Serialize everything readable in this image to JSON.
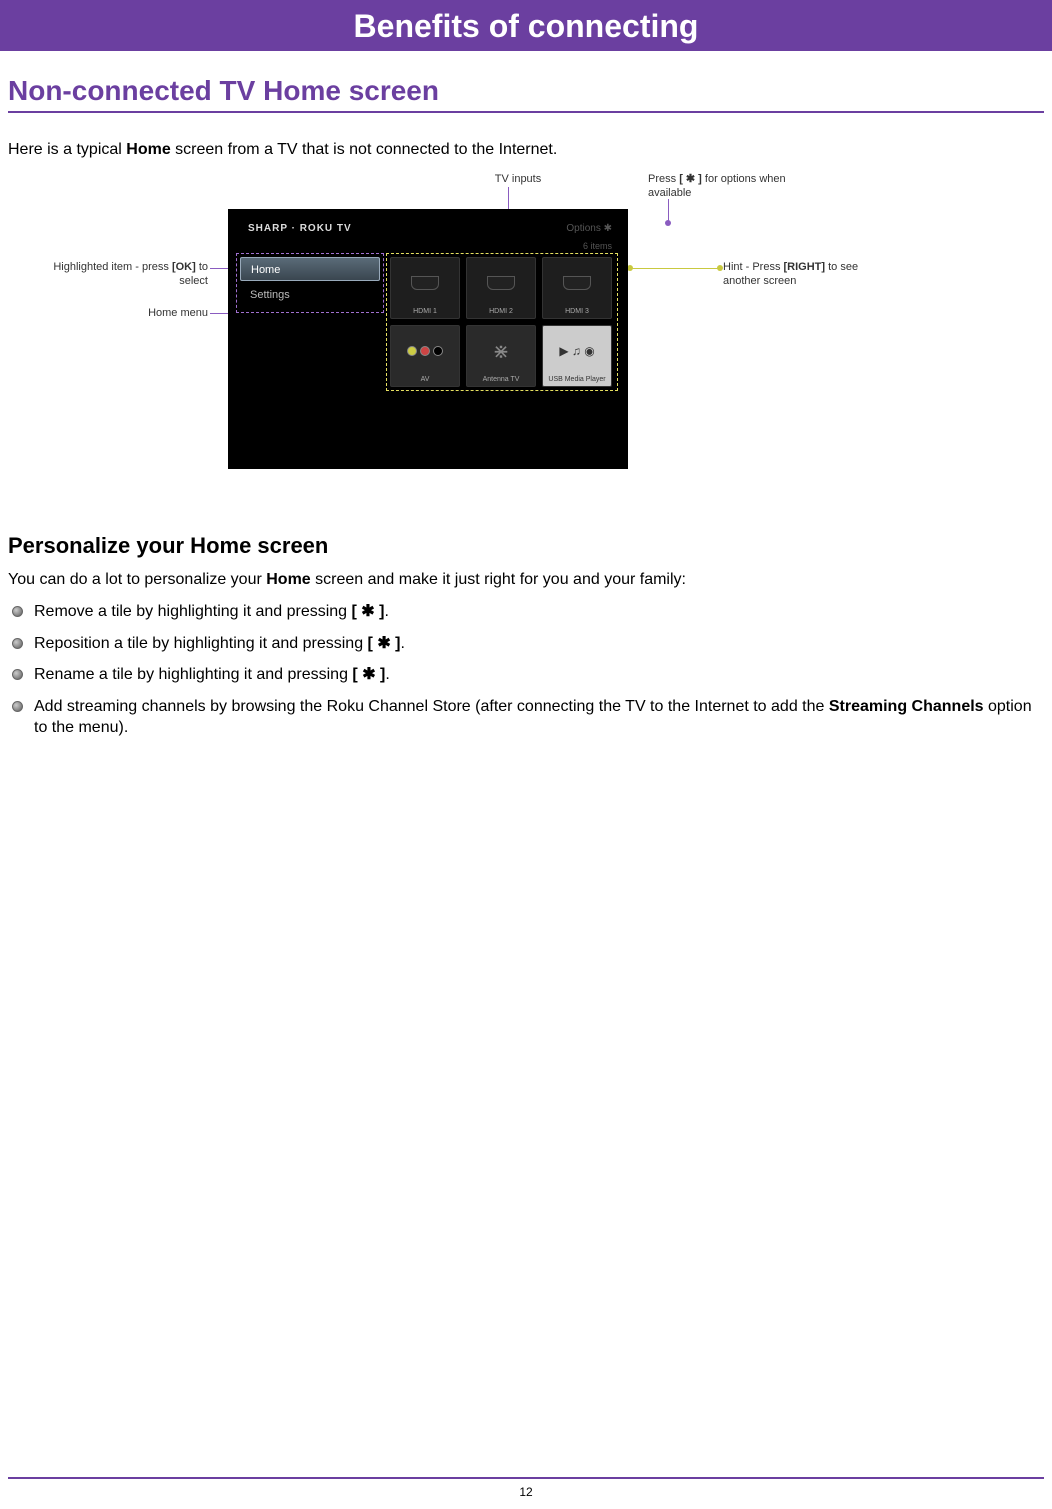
{
  "banner": "Benefits of connecting",
  "h1": "Non-connected TV Home screen",
  "intro_pre": "Here is a typical ",
  "intro_bold": "Home",
  "intro_post": " screen from a TV that is not connected to the Internet.",
  "callouts": {
    "tv_inputs": "TV inputs",
    "options_pre": "Press ",
    "options_key": "[ ✱ ]",
    "options_post": " for options when available",
    "highlight_pre": "Highlighted item - press ",
    "highlight_key": "[OK]",
    "highlight_post": " to select",
    "home_menu": "Home menu",
    "hint_pre": "Hint - Press ",
    "hint_key": "[RIGHT]",
    "hint_post": " to see another screen"
  },
  "tv": {
    "logo": "SHARP · ROKU TV",
    "options": "Options ✱",
    "items": "6 items",
    "menu": {
      "home": "Home",
      "settings": "Settings"
    },
    "tiles": {
      "hdmi1": "HDMI 1",
      "hdmi2": "HDMI 2",
      "hdmi3": "HDMI 3",
      "av": "AV",
      "antenna": "Antenna TV",
      "usb": "USB Media Player"
    }
  },
  "h2": "Personalize your Home screen",
  "p2_pre": "You can do a lot to personalize your ",
  "p2_bold": "Home",
  "p2_post": " screen and make it just right for you and your family:",
  "bullets": {
    "b1_pre": "Remove a tile by highlighting it and pressing ",
    "b1_key": "[ ✱ ]",
    "b1_post": ".",
    "b2_pre": "Reposition a tile by highlighting it and pressing ",
    "b2_key": "[ ✱ ]",
    "b2_post": ".",
    "b3_pre": "Rename a tile by highlighting it and pressing ",
    "b3_key": "[ ✱ ]",
    "b3_post": ".",
    "b4_pre": "Add streaming channels by browsing the Roku Channel Store (after connecting the TV to the Internet to add the ",
    "b4_bold": "Streaming Channels",
    "b4_post": " option to the menu)."
  },
  "page": "12"
}
